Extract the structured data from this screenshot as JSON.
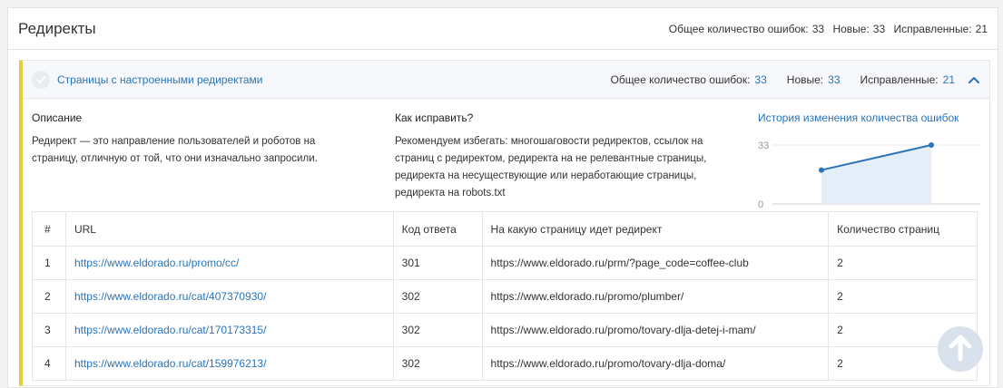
{
  "header": {
    "title": "Редиректы",
    "total_label": "Общее количество ошибок:",
    "total_value": "33",
    "new_label": "Новые:",
    "new_value": "33",
    "fixed_label": "Исправленные:",
    "fixed_value": "21"
  },
  "section": {
    "title": "Страницы с настроенными редиректами",
    "total_label": "Общее количество ошибок:",
    "total_value": "33",
    "new_label": "Новые:",
    "new_value": "33",
    "fixed_label": "Исправленные:",
    "fixed_value": "21",
    "accent_color": "#e2cf3a",
    "link_color": "#2b73b8"
  },
  "description": {
    "heading": "Описание",
    "text": "Редирект — это направление пользователей и роботов на страницу, отличную от той, что они изначально запросили."
  },
  "fix": {
    "heading": "Как исправить?",
    "text": "Рекомендуем избегать: многошаговости редиректов, ссылок на страниц с редиректом, редиректа на не релевантные страницы, редиректа на несуществующие или неработающие страницы, редиректа на robots.txt"
  },
  "history": {
    "title": "История изменения количества ошибок",
    "y_max_label": "33",
    "y_min_label": "0"
  },
  "chart_data": {
    "type": "area",
    "ylim": [
      0,
      33
    ],
    "series": [
      {
        "values": [
          19,
          33
        ]
      }
    ]
  },
  "table": {
    "headers": [
      "#",
      "URL",
      "Код ответа",
      "На какую страницу идет редирект",
      "Количество страниц"
    ],
    "rows": [
      {
        "n": "1",
        "url": "https://www.eldorado.ru/promo/cc/",
        "code": "301",
        "target": "https://www.eldorado.ru/prm/?page_code=coffee-club",
        "count": "2"
      },
      {
        "n": "2",
        "url": "https://www.eldorado.ru/cat/407370930/",
        "code": "302",
        "target": "https://www.eldorado.ru/promo/plumber/",
        "count": "2"
      },
      {
        "n": "3",
        "url": "https://www.eldorado.ru/cat/170173315/",
        "code": "302",
        "target": "https://www.eldorado.ru/promo/tovary-dlja-detej-i-mam/",
        "count": "2"
      },
      {
        "n": "4",
        "url": "https://www.eldorado.ru/cat/159976213/",
        "code": "302",
        "target": "https://www.eldorado.ru/promo/tovary-dlja-doma/",
        "count": "2"
      }
    ]
  },
  "icons": {
    "section_status": "check-circle-icon",
    "collapse": "chevron-up-icon",
    "scroll_top": "arrow-up-icon"
  }
}
